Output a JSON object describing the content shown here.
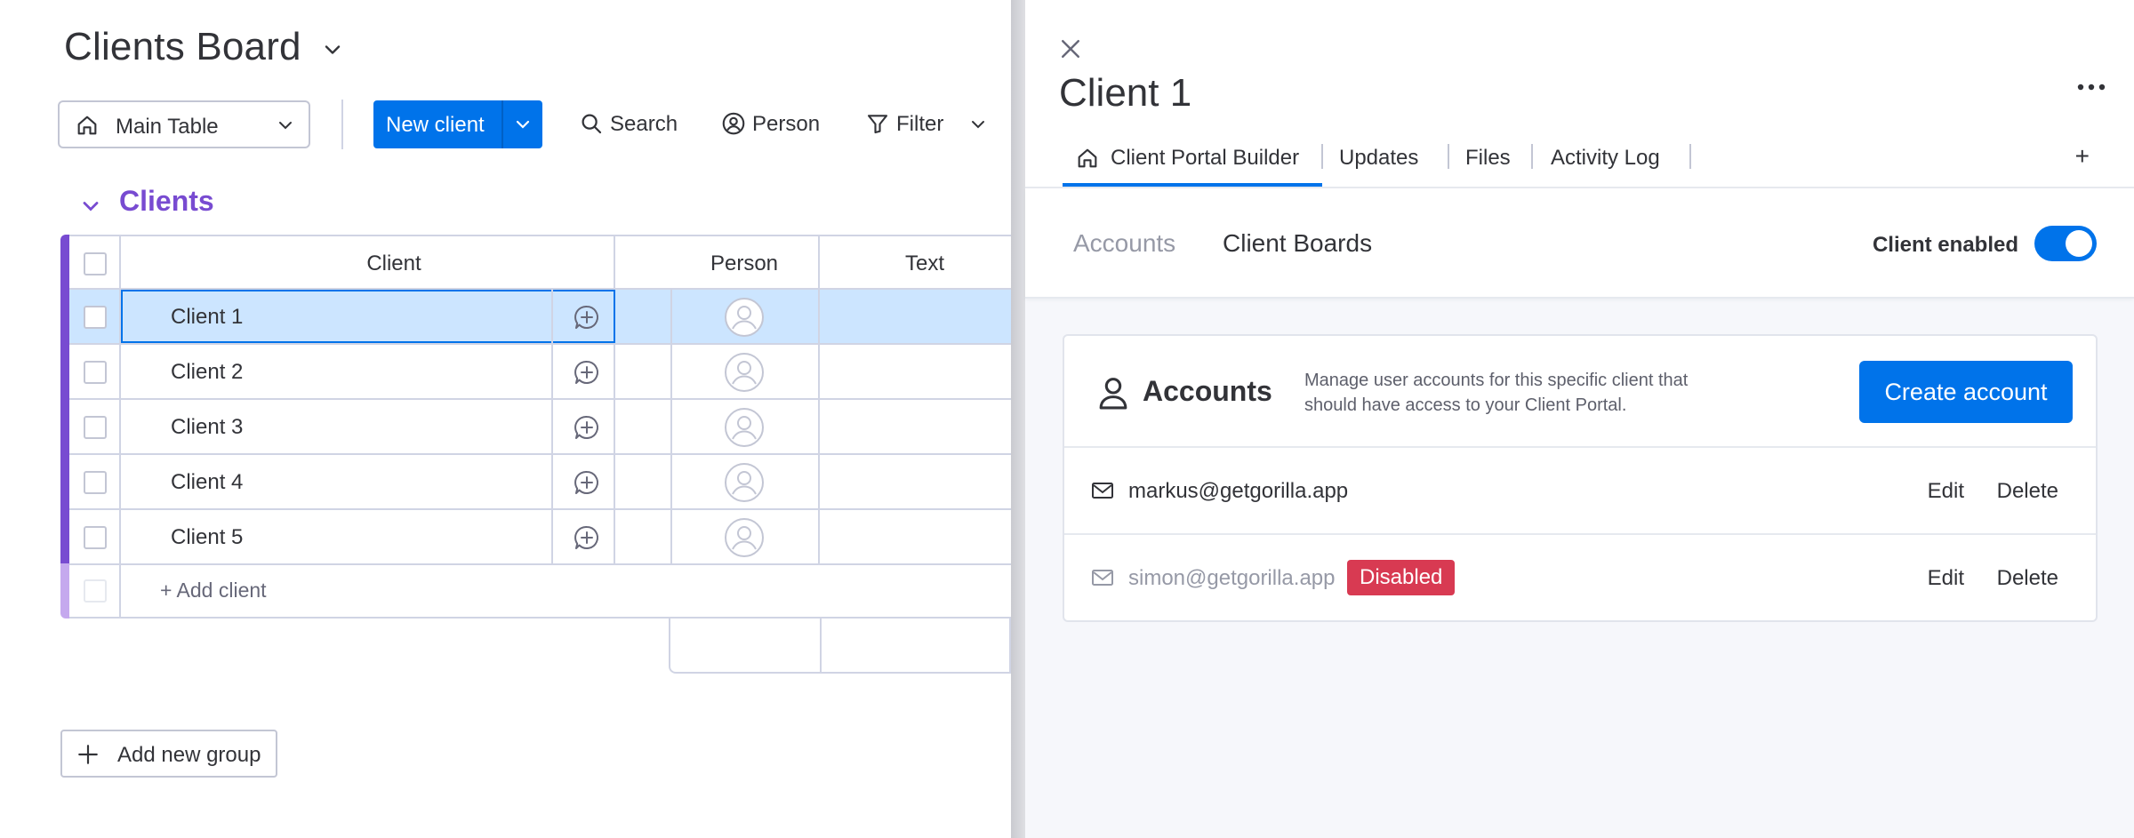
{
  "board": {
    "title": "Clients Board",
    "view_label": "Main Table",
    "new_button_label": "New client",
    "search_label": "Search",
    "person_label": "Person",
    "filter_label": "Filter",
    "group_name": "Clients",
    "group_color": "#784bd1",
    "columns": [
      "Client",
      "Person",
      "Text"
    ],
    "rows": [
      {
        "name": "Client 1",
        "selected": true
      },
      {
        "name": "Client 2",
        "selected": false
      },
      {
        "name": "Client 3",
        "selected": false
      },
      {
        "name": "Client 4",
        "selected": false
      },
      {
        "name": "Client 5",
        "selected": false
      }
    ],
    "add_item_label": "+ Add client",
    "add_group_label": "Add new group"
  },
  "panel": {
    "title": "Client 1",
    "tabs": [
      "Client Portal Builder",
      "Updates",
      "Files",
      "Activity Log"
    ],
    "active_tab": "Client Portal Builder",
    "add_tab_label": "+",
    "sub_tabs": [
      "Accounts",
      "Client Boards"
    ],
    "client_enabled_label": "Client enabled",
    "client_enabled": true,
    "accounts": {
      "title": "Accounts",
      "description": "Manage user accounts for this specific client that should have access to your Client Portal.",
      "create_label": "Create account",
      "items": [
        {
          "email": "markus@getgorilla.app",
          "disabled": false,
          "edit": "Edit",
          "delete": "Delete"
        },
        {
          "email": "simon@getgorilla.app",
          "disabled": true,
          "badge": "Disabled",
          "edit": "Edit",
          "delete": "Delete"
        }
      ]
    }
  },
  "colors": {
    "primary": "#0073ea",
    "danger": "#d83a52",
    "selected_row": "#cce5ff"
  }
}
